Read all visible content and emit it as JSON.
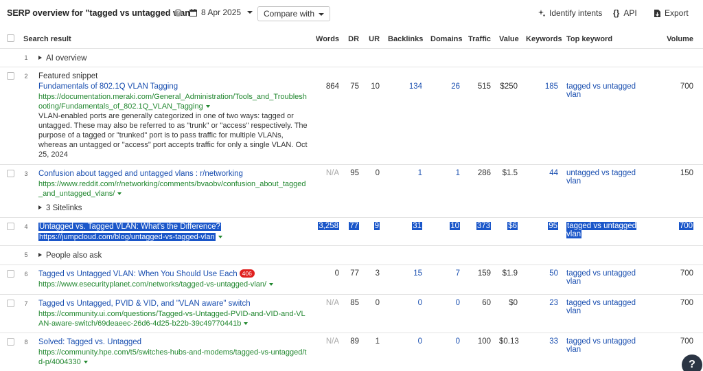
{
  "header": {
    "title": "SERP overview for \"tagged vs untagged vlan\"",
    "help_glyph": "?",
    "date": "8 Apr 2025",
    "compare_label": "Compare with",
    "identify_label": "Identify intents",
    "api_label": "API",
    "export_label": "Export"
  },
  "columns": {
    "search_result": "Search result",
    "words": "Words",
    "dr": "DR",
    "ur": "UR",
    "backlinks": "Backlinks",
    "domains": "Domains",
    "traffic": "Traffic",
    "value": "Value",
    "keywords": "Keywords",
    "top_keyword": "Top keyword",
    "volume": "Volume"
  },
  "rows": {
    "r1": {
      "pos": "1",
      "label": "AI overview"
    },
    "r2": {
      "pos": "2",
      "type": "Featured snippet",
      "title": "Fundamentals of 802.1Q VLAN Tagging",
      "url": "https://documentation.meraki.com/General_Administration/Tools_and_Troubleshooting/Fundamentals_of_802.1Q_VLAN_Tagging",
      "desc": "VLAN-enabled ports are generally categorized in one of two ways: tagged or untagged. These may also be referred to as \"trunk\" or \"access\" respectively. The purpose of a tagged or \"trunked\" port is to pass traffic for multiple VLANs, whereas an untagged or \"access\" port accepts traffic for only a single VLAN. Oct 25, 2024",
      "words": "864",
      "dr": "75",
      "ur": "10",
      "backlinks": "134",
      "domains": "26",
      "traffic": "515",
      "value": "$250",
      "keywords": "185",
      "top_keyword": "tagged vs untagged vlan",
      "volume": "700"
    },
    "r3": {
      "pos": "3",
      "title": "Confusion about tagged and untagged vlans : r/networking",
      "url": "https://www.reddit.com/r/networking/comments/bvaobv/confusion_about_tagged_and_untagged_vlans/",
      "sitelinks": "3 Sitelinks",
      "words": "N/A",
      "dr": "95",
      "ur": "0",
      "backlinks": "1",
      "domains": "1",
      "traffic": "286",
      "value": "$1.5",
      "keywords": "44",
      "top_keyword": "untagged vs tagged vlan",
      "volume": "150"
    },
    "r4": {
      "pos": "4",
      "title": "Untagged vs. Tagged VLAN: What's the Difference?",
      "url": "https://jumpcloud.com/blog/untagged-vs-tagged-vlan",
      "words": "3,258",
      "dr": "77",
      "ur": "9",
      "backlinks": "31",
      "domains": "10",
      "traffic": "373",
      "value": "$6",
      "keywords": "95",
      "top_keyword": "tagged vs untagged vlan",
      "volume": "700"
    },
    "r5": {
      "pos": "5",
      "label": "People also ask"
    },
    "r6": {
      "pos": "6",
      "title": "Tagged vs Untagged VLAN: When You Should Use Each",
      "badge": "406",
      "url": "https://www.esecurityplanet.com/networks/tagged-vs-untagged-vlan/",
      "words": "0",
      "dr": "77",
      "ur": "3",
      "backlinks": "15",
      "domains": "7",
      "traffic": "159",
      "value": "$1.9",
      "keywords": "50",
      "top_keyword": "tagged vs untagged vlan",
      "volume": "700"
    },
    "r7": {
      "pos": "7",
      "title": "Tagged vs Untagged, PVID & VID, and \"VLAN aware\" switch",
      "url": "https://community.ui.com/questions/Tagged-vs-Untagged-PVID-and-VID-and-VLAN-aware-switch/69deaeec-26d6-4d25-b22b-39c49770441b",
      "words": "N/A",
      "dr": "85",
      "ur": "0",
      "backlinks": "0",
      "domains": "0",
      "traffic": "60",
      "value": "$0",
      "keywords": "23",
      "top_keyword": "tagged vs untagged vlan",
      "volume": "700"
    },
    "r8": {
      "pos": "8",
      "title": "Solved: Tagged vs. Untagged",
      "url": "https://community.hpe.com/t5/switches-hubs-and-modems/tagged-vs-untagged/td-p/4004330",
      "words": "N/A",
      "dr": "89",
      "ur": "1",
      "backlinks": "0",
      "domains": "0",
      "traffic": "100",
      "value": "$0.13",
      "keywords": "33",
      "top_keyword": "tagged vs untagged vlan",
      "volume": "700"
    }
  },
  "help_fab": "?",
  "colors": {
    "link": "#1a4fb0",
    "url": "#21872f",
    "selection": "#1a56c9",
    "badge": "#e0201e"
  }
}
